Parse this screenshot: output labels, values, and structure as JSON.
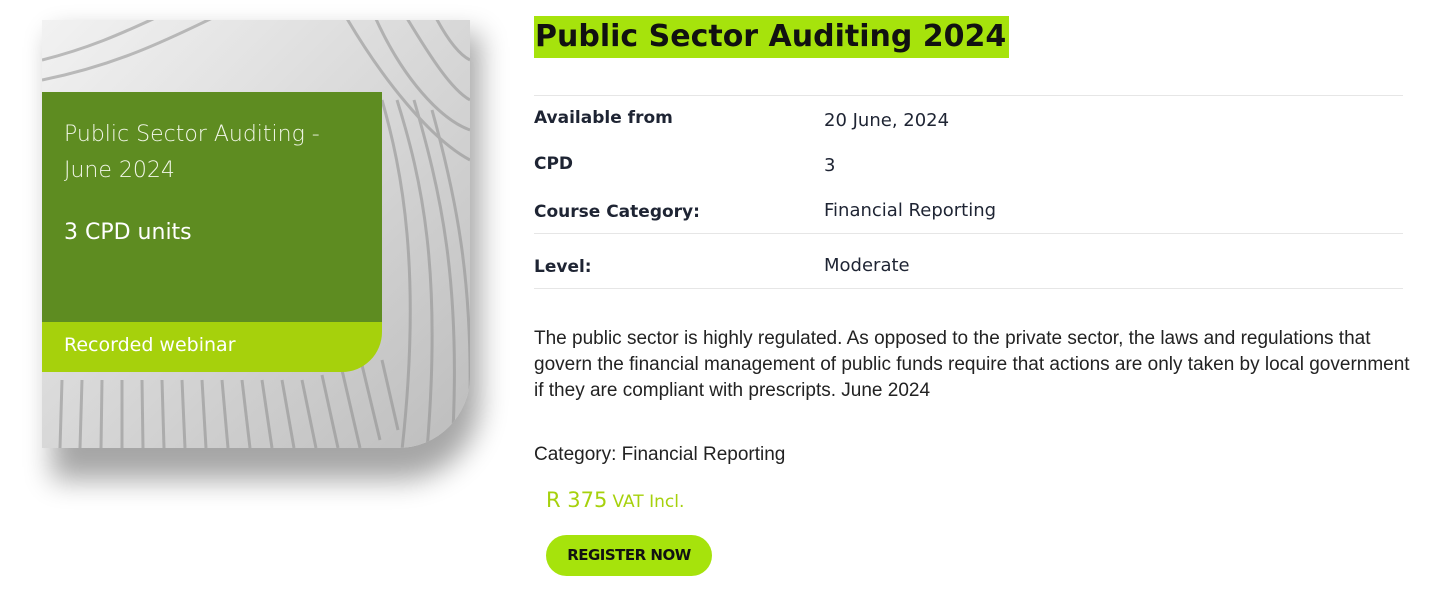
{
  "product": {
    "title": "Public Sector Auditing 2024",
    "image": {
      "title": "Public Sector Auditing - June 2024",
      "units": "3 CPD units",
      "format": "Recorded webinar"
    },
    "details": [
      {
        "label": "Available from",
        "value": "20 June, 2024"
      },
      {
        "label": "CPD",
        "value": "3"
      },
      {
        "label": "Course Category:",
        "value": "Financial Reporting"
      },
      {
        "label": "Level:",
        "value": "Moderate"
      }
    ],
    "description": "The public sector is highly regulated. As opposed to the private sector, the laws and regulations that govern the financial management of public funds require that actions are only taken by local government if they are compliant with prescripts. June 2024",
    "category_line": "Category: Financial Reporting",
    "price": {
      "amount": "R 375",
      "suffix": "VAT Incl."
    },
    "register_label": "REGISTER NOW"
  },
  "colors": {
    "accent_lime": "#a6e30c",
    "dark_green": "#5e8c21",
    "price_green": "#a6d10c"
  }
}
